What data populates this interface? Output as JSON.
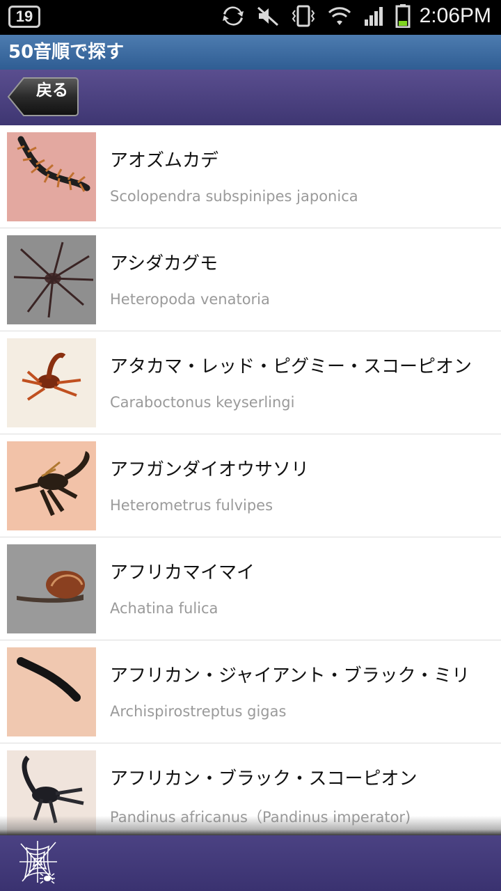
{
  "status_bar": {
    "notification_count": "19",
    "time": "2:06PM",
    "icons": [
      "sync-icon",
      "mute-icon",
      "vibrate-icon",
      "wifi-icon",
      "signal-icon",
      "battery-icon"
    ]
  },
  "title_bar": {
    "title": "50音順で探す"
  },
  "nav_bar": {
    "back_label": "戻る"
  },
  "list": {
    "items": [
      {
        "name_ja": "アオズムカデ",
        "name_sci": "Scolopendra subspinipes japonica",
        "thumb": "centipede-image"
      },
      {
        "name_ja": "アシダカグモ",
        "name_sci": "Heteropoda venatoria",
        "thumb": "spider-image"
      },
      {
        "name_ja": "アタカマ・レッド・ピグミー・スコーピオン",
        "name_sci": "Caraboctonus keyserlingi",
        "thumb": "red-scorpion-image"
      },
      {
        "name_ja": "アフガンダイオウサソリ",
        "name_sci": "Heterometrus fulvipes",
        "thumb": "dark-scorpion-image"
      },
      {
        "name_ja": "アフリカマイマイ",
        "name_sci": "Achatina fulica",
        "thumb": "snail-image"
      },
      {
        "name_ja": "アフリカン・ジャイアント・ブラック・ミリ",
        "name_sci": "Archispirostreptus gigas",
        "thumb": "millipede-image"
      },
      {
        "name_ja": "アフリカン・ブラック・スコーピオン",
        "name_sci": "Pandinus africanus（Pandinus imperator)",
        "thumb": "black-scorpion-image"
      }
    ]
  },
  "bottom_bar": {
    "icon": "spider-web-icon"
  },
  "colors": {
    "title_bar": "#3d6aa0",
    "nav_bar": "#4c4381",
    "sci_text": "#9a9a9a"
  }
}
